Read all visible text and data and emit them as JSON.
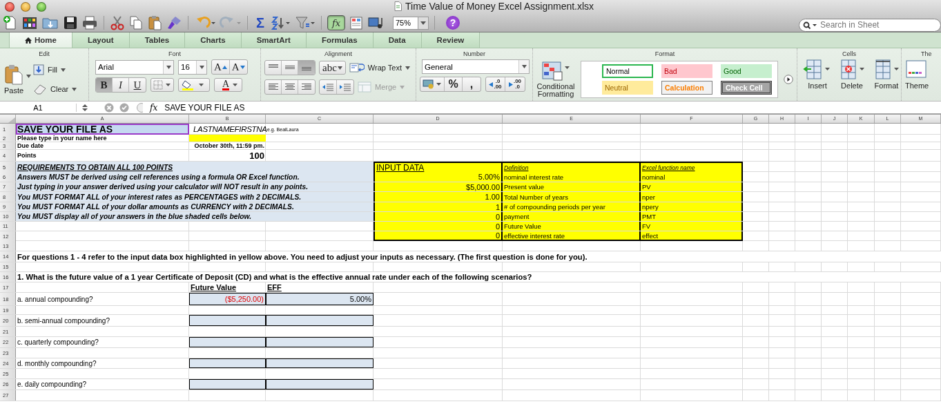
{
  "window": {
    "title": "Time Value of Money Excel Assignment.xlsx"
  },
  "toolbar": {
    "sum_label": "Σ",
    "formula_builder": {
      "label": "fx",
      "on": true
    },
    "zoom": "75%",
    "help_label": "?",
    "search": {
      "placeholder": "Search in Sheet"
    }
  },
  "tabs": [
    {
      "label": "Home",
      "selected": true
    },
    {
      "label": "Layout",
      "selected": false
    },
    {
      "label": "Tables",
      "selected": false
    },
    {
      "label": "Charts",
      "selected": false
    },
    {
      "label": "SmartArt",
      "selected": false
    },
    {
      "label": "Formulas",
      "selected": false
    },
    {
      "label": "Data",
      "selected": false
    },
    {
      "label": "Review",
      "selected": false
    }
  ],
  "ribbon": {
    "edit": {
      "label": "Edit",
      "paste": "Paste",
      "fill": "Fill",
      "clear": "Clear"
    },
    "font": {
      "label": "Font",
      "name": "Arial",
      "size": "16",
      "grow": "A",
      "shrink": "A",
      "bold": {
        "label": "B",
        "on": true
      },
      "italic": {
        "label": "I",
        "on": false
      },
      "underline": {
        "label": "U",
        "on": false
      },
      "font_color": "A"
    },
    "alignment": {
      "label": "Alignment",
      "vertical_align": [
        {
          "selected": false
        },
        {
          "selected": false
        },
        {
          "selected": true
        }
      ],
      "horizontal_align": [
        {
          "selected": false
        },
        {
          "selected": false
        },
        {
          "selected": false
        }
      ],
      "orientation": "abc",
      "wrap": "Wrap Text",
      "merge": {
        "label": "Merge",
        "disabled": true
      }
    },
    "number": {
      "label": "Number",
      "format": "General",
      "percent": "%",
      "comma": ",",
      "increase_decimals": [
        ".0",
        ".00"
      ],
      "decrease_decimals": [
        ".00",
        ".0"
      ]
    },
    "format": {
      "label": "Format",
      "conditional": "Conditional Formatting",
      "styles": [
        {
          "label": "Normal",
          "kind": "normal",
          "selected": true
        },
        {
          "label": "Bad",
          "kind": "bad",
          "selected": false
        },
        {
          "label": "Good",
          "kind": "good",
          "selected": false
        },
        {
          "label": "Neutral",
          "kind": "neutral",
          "selected": false
        },
        {
          "label": "Calculation",
          "kind": "calculation",
          "selected": false
        },
        {
          "label": "Check Cell",
          "kind": "check",
          "selected": false
        }
      ]
    },
    "cells": {
      "label": "Cells",
      "buttons": [
        "Insert",
        "Delete",
        "Format"
      ]
    },
    "themes": {
      "label": "The",
      "button": "Theme"
    }
  },
  "formula_bar": {
    "name_box": "A1",
    "fx": "fx",
    "content": "SAVE YOUR FILE AS"
  },
  "sheet": {
    "columns": [
      "A",
      "B",
      "C",
      "D",
      "E",
      "F",
      "G",
      "H",
      "I",
      "J",
      "K",
      "L",
      "M"
    ],
    "rows": [
      {
        "number": "1",
        "cells": {
          "a": {
            "text": "SAVE YOUR FILE AS",
            "kind": "title",
            "selected": true
          },
          "b": {
            "text": "LASTNAMEFIRSTNA",
            "kind": "italic"
          },
          "c": {
            "text": "e.g. BealLaura",
            "kind": "note"
          }
        }
      },
      {
        "number": "2",
        "cells": {
          "a": {
            "text": "Please type in your name here",
            "kind": "label"
          },
          "b": {
            "kind": "yellow"
          }
        }
      },
      {
        "number": "3",
        "cells": {
          "a": {
            "text": "Due date",
            "kind": "label"
          },
          "b": {
            "text": "October 30th, 11:59 pm.",
            "kind": "label_right"
          }
        }
      },
      {
        "number": "4",
        "cells": {
          "a": {
            "text": "Points",
            "kind": "label"
          },
          "b": {
            "text": "100",
            "kind": "points"
          }
        }
      },
      {
        "number": "5",
        "cells": {
          "a": {
            "text": "REQUIREMENTS TO OBTAIN ALL 100 POINTS",
            "kind": "requirement_head"
          },
          "d": {
            "text": "INPUT DATA",
            "kind": "box_head"
          },
          "e": {
            "text": "Definition",
            "kind": "box_caption"
          },
          "f": {
            "text": "Excel function name",
            "kind": "box_caption"
          }
        }
      },
      {
        "number": "6",
        "cells": {
          "a": {
            "text": "Answers MUST be derived using cell references using a formula OR Excel function.",
            "kind": "requirement"
          },
          "d": {
            "text": "5.00%",
            "kind": "box_value"
          },
          "e": {
            "text": "nominal interest rate",
            "kind": "box_text"
          },
          "f": {
            "text": "nominal",
            "kind": "box_text"
          }
        }
      },
      {
        "number": "7",
        "cells": {
          "a": {
            "text": "Just typing in your answer derived using your calculator will NOT result in any points.",
            "kind": "requirement"
          },
          "d": {
            "text": "$5,000.00",
            "kind": "box_value"
          },
          "e": {
            "text": "Present value",
            "kind": "box_text"
          },
          "f": {
            "text": "PV",
            "kind": "box_text"
          }
        }
      },
      {
        "number": "8",
        "cells": {
          "a": {
            "text": "You MUST FORMAT ALL of your interest rates as PERCENTAGES with 2 DECIMALS.",
            "kind": "requirement"
          },
          "d": {
            "text": "1.00",
            "kind": "box_value"
          },
          "e": {
            "text": "Total Number of years",
            "kind": "box_text"
          },
          "f": {
            "text": "nper",
            "kind": "box_text"
          }
        }
      },
      {
        "number": "9",
        "cells": {
          "a": {
            "text": "You MUST FORMAT ALL of your dollar amounts as CURRENCY with 2 DECIMALS.",
            "kind": "requirement"
          },
          "d": {
            "text": "1",
            "kind": "box_value"
          },
          "e": {
            "text": "# of compounding periods per year",
            "kind": "box_text"
          },
          "f": {
            "text": "npery",
            "kind": "box_text"
          }
        }
      },
      {
        "number": "10",
        "cells": {
          "a": {
            "text": "You MUST display all of your answers in the blue shaded cells below.",
            "kind": "requirement"
          },
          "d": {
            "text": "0",
            "kind": "box_value"
          },
          "e": {
            "text": "payment",
            "kind": "box_text"
          },
          "f": {
            "text": "PMT",
            "kind": "box_text"
          }
        }
      },
      {
        "number": "11",
        "cells": {
          "d": {
            "text": "0",
            "kind": "box_value"
          },
          "e": {
            "text": "Future Value",
            "kind": "box_text"
          },
          "f": {
            "text": "FV",
            "kind": "box_text"
          }
        }
      },
      {
        "number": "12",
        "cells": {
          "d": {
            "text": "0",
            "kind": "box_value"
          },
          "e": {
            "text": "effective interest rate",
            "kind": "box_text"
          },
          "f": {
            "text": "effect",
            "kind": "box_text"
          }
        }
      },
      {
        "number": "13"
      },
      {
        "number": "14",
        "cells": {
          "a": {
            "text": "For questions 1 - 4 refer to the input data box highlighted in yellow above. You need to adjust your inputs as necessary. (The first question is done for you).",
            "kind": "heading"
          }
        }
      },
      {
        "number": "15"
      },
      {
        "number": "16",
        "cells": {
          "a": {
            "text": "1. What is the future value of a 1 year Certificate of Deposit (CD) and what is the effective annual rate under each of the following scenarios?",
            "kind": "heading"
          }
        }
      },
      {
        "number": "17",
        "cells": {
          "b": {
            "text": "Future Value",
            "kind": "col_head"
          },
          "c": {
            "text": "EFF",
            "kind": "col_head"
          }
        }
      },
      {
        "number": "18",
        "cells": {
          "a": {
            "text": "a. annual compounding?",
            "kind": "text"
          },
          "b": {
            "text": "($5,250.00)",
            "kind": "answer_negative"
          },
          "c": {
            "text": "5.00%",
            "kind": "answer"
          }
        }
      },
      {
        "number": "19"
      },
      {
        "number": "20",
        "cells": {
          "a": {
            "text": "b. semi-annual compounding?",
            "kind": "text"
          },
          "b": {
            "kind": "answer"
          },
          "c": {
            "kind": "answer"
          }
        }
      },
      {
        "number": "21"
      },
      {
        "number": "22",
        "cells": {
          "a": {
            "text": "c. quarterly compounding?",
            "kind": "text"
          },
          "b": {
            "kind": "answer"
          },
          "c": {
            "kind": "answer"
          }
        }
      },
      {
        "number": "23"
      },
      {
        "number": "24",
        "cells": {
          "a": {
            "text": "d. monthly compounding?",
            "kind": "text"
          },
          "b": {
            "kind": "answer"
          },
          "c": {
            "kind": "answer"
          }
        }
      },
      {
        "number": "25"
      },
      {
        "number": "26",
        "cells": {
          "a": {
            "text": "e. daily compounding?",
            "kind": "text"
          },
          "b": {
            "kind": "answer"
          },
          "c": {
            "kind": "answer"
          }
        }
      },
      {
        "number": "27"
      }
    ]
  }
}
